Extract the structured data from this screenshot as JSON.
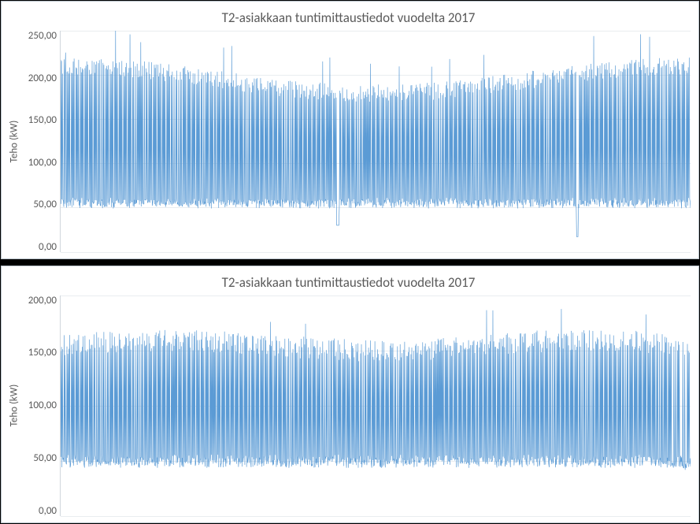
{
  "chart_data": [
    {
      "type": "line",
      "title": "T2-asiakkaan tuntimittaustiedot vuodelta 2017",
      "ylabel": "Teho (kW)",
      "xlabel": "",
      "ylim": [
        0,
        250
      ],
      "yticks": [
        "250,00",
        "200,00",
        "150,00",
        "100,00",
        "50,00",
        "0,00"
      ],
      "series_color": "#5b9bd5",
      "description": "Hourly power measurement time series for customer T2, year 2017. Dense oscillation between roughly 50 kW baseline and ~200 kW peaks, with occasional higher spikes to ~230 kW early in the year and a single low dip near ~20-30 kW mid-series and one near ~15 kW later.",
      "approx_envelope": {
        "low_min": 30,
        "low_typ": 55,
        "high_typ": 195,
        "high_max": 232
      }
    },
    {
      "type": "line",
      "title": "T2-asiakkaan tuntimittaustiedot vuodelta 2017",
      "ylabel": "Teho (kW)",
      "xlabel": "",
      "ylim": [
        0,
        200
      ],
      "yticks": [
        "200,00",
        "150,00",
        "100,00",
        "50,00",
        "0,00"
      ],
      "series_color": "#5b9bd5",
      "description": "Second view of hourly power measurement time series for customer T2, year 2017. Dense oscillation between roughly 45-50 kW baseline and ~150-165 kW peaks, occasional spikes to ~175-180 kW, slight dip on far right toward ~40 kW.",
      "approx_envelope": {
        "low_min": 40,
        "low_typ": 50,
        "high_typ": 155,
        "high_max": 182
      }
    }
  ]
}
